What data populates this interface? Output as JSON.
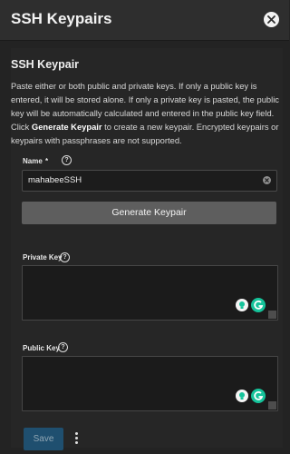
{
  "header": {
    "title": "SSH Keypairs"
  },
  "form": {
    "section_title": "SSH Keypair",
    "description_part1": "Paste either or both public and private keys. If only a public key is entered, it will be stored alone. If only a private key is pasted, the public key will be automatically calculated and entered in the public key field. Click ",
    "description_bold1": "Generate Keypair",
    "description_part2": " to create a new keypair. Encrypted keypairs or keypairs with passphrases are not supported.",
    "name_label": "Name",
    "name_required_mark": "*",
    "name_value": "mahabeeSSH",
    "generate_button_label": "Generate Keypair",
    "private_key_label": "Private Key",
    "private_key_value": "",
    "public_key_label": "Public Key",
    "public_key_value": "",
    "save_button_label": "Save"
  },
  "icons": {
    "close": "close-icon",
    "help": "help-icon",
    "clear": "clear-icon",
    "grammarly_bulb": "lightbulb-icon",
    "grammarly_logo": "grammarly-icon",
    "more": "more-vertical-icon"
  },
  "colors": {
    "background": "#232323",
    "header_bg": "#2e2e2e",
    "generate_button_bg": "#5e5e5e",
    "save_button_bg": "#1f4f6f",
    "grammarly_green": "#15c39a"
  }
}
